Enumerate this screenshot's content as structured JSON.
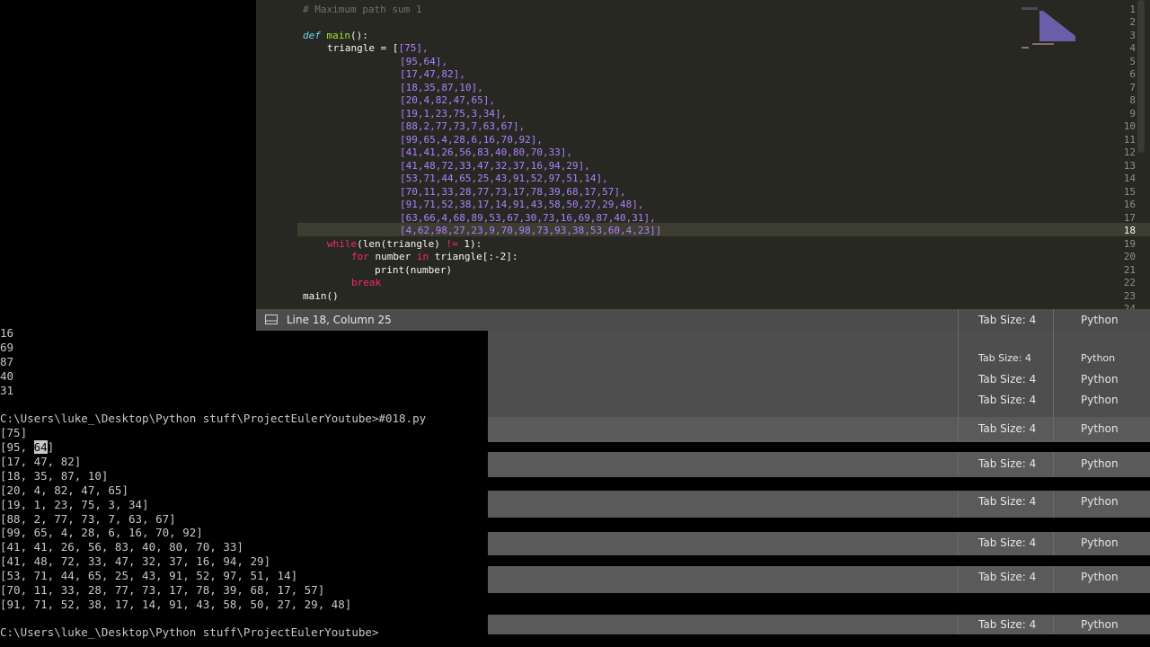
{
  "editor": {
    "line_numbers": [
      "1",
      "2",
      "3",
      "4",
      "5",
      "6",
      "7",
      "8",
      "9",
      "10",
      "11",
      "12",
      "13",
      "14",
      "15",
      "16",
      "17",
      "18",
      "19",
      "20",
      "21",
      "22",
      "23",
      "24"
    ],
    "active_line": 18,
    "comment": "# Maximum path sum 1",
    "def_keyword": "def",
    "func_name": "main",
    "func_sig_rest": "():",
    "triangle_head": "triangle = [",
    "rows": [
      "[75],",
      "[95,64],",
      "[17,47,82],",
      "[18,35,87,10],",
      "[20,4,82,47,65],",
      "[19,1,23,75,3,34],",
      "[88,2,77,73,7,63,67],",
      "[99,65,4,28,6,16,70,92],",
      "[41,41,26,56,83,40,80,70,33],",
      "[41,48,72,33,47,32,37,16,94,29],",
      "[53,71,44,65,25,43,91,52,97,51,14],",
      "[70,11,33,28,77,73,17,78,39,68,17,57],",
      "[91,71,52,38,17,14,91,43,58,50,27,29,48],",
      "[63,66,4,68,89,53,67,30,73,16,69,87,40,31],",
      "[4,62,98,27,23,9,70,98,73,93,38,53,60,4,23]]"
    ],
    "while_kw": "while",
    "while_rest_a": "(len(triangle) ",
    "while_op": "!=",
    "while_rest_b": " 1):",
    "for_kw": "for",
    "for_var": " number ",
    "in_kw": "in",
    "for_rest": " triangle[:-2]:",
    "print_stmt": "print(number)",
    "break_kw": "break",
    "main_call": "main()"
  },
  "status": {
    "position": "Line 18, Column 25",
    "tab_size": "Tab Size: 4",
    "language": "Python"
  },
  "console": {
    "top_lines": [
      "16",
      "69",
      "87",
      "40",
      "31"
    ],
    "prompt1": "C:\\Users\\luke_\\Desktop\\Python stuff\\ProjectEulerYoutube>#018.py",
    "out_first": "[75]",
    "out_second_a": "[95, ",
    "out_second_cursor": "64",
    "out_second_b": "]",
    "out_rest": [
      "[17, 47, 82]",
      "[18, 35, 87, 10]",
      "[20, 4, 82, 47, 65]",
      "[19, 1, 23, 75, 3, 34]",
      "[88, 2, 77, 73, 7, 63, 67]",
      "[99, 65, 4, 28, 6, 16, 70, 92]",
      "[41, 41, 26, 56, 83, 40, 80, 70, 33]",
      "[41, 48, 72, 33, 47, 32, 37, 16, 94, 29]",
      "[53, 71, 44, 65, 25, 43, 91, 52, 97, 51, 14]",
      "[70, 11, 33, 28, 77, 73, 17, 78, 39, 68, 17, 57]",
      "[91, 71, 52, 38, 17, 14, 91, 43, 58, 50, 27, 29, 48]"
    ],
    "prompt2": "C:\\Users\\luke_\\Desktop\\Python stuff\\ProjectEulerYoutube>"
  }
}
